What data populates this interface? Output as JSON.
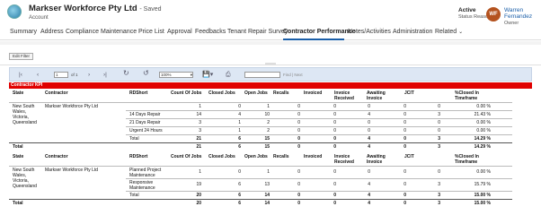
{
  "header": {
    "account_name": "Markser Workforce Pty Ltd",
    "saved_label": "- Saved",
    "entity_type": "Account",
    "status_value": "Active",
    "status_label": "Status Reason",
    "owner_initials": "WF",
    "owner_name": "Warren Fernandez",
    "owner_label": "Owner"
  },
  "tabs": [
    "Summary",
    "Address",
    "Compliance",
    "Maintenance",
    "Price List",
    "Approval",
    "Feedbacks",
    "Tenant Repair Survey",
    "Contractor Performance",
    "Notes/Activities",
    "Administration",
    "Related"
  ],
  "active_tab": "Contractor Performance",
  "toolbar": {
    "edit_filter": "Edit Filter",
    "page_number": "1",
    "of_pages": "of 1",
    "zoom": "100%",
    "find_placeholder": "",
    "find_next": "Find | Next"
  },
  "report": {
    "title": "Contractor KPI",
    "columns": [
      "State",
      "Contractor",
      "RDShort",
      "Count Of Jobs",
      "Closed Jobs",
      "Open Jobs",
      "Recalls",
      "Invoiced",
      "Invoice Received",
      "Awaiting Invoice",
      "JCIT",
      "%Closed In Timeframe"
    ],
    "section1": {
      "state": "New South Wales, Victoria, Queensland",
      "contractor": "Markser Workforce Pty Ltd",
      "rows": [
        {
          "rd": "",
          "count": "1",
          "closed": "0",
          "open": "1",
          "recalls": "0",
          "invoiced": "0",
          "inv_received": "0",
          "awaiting": "0",
          "jcit": "0",
          "pct": "0.00 %"
        },
        {
          "rd": "14 Days Repair",
          "count": "14",
          "closed": "4",
          "open": "10",
          "recalls": "0",
          "invoiced": "0",
          "inv_received": "4",
          "awaiting": "0",
          "jcit": "3",
          "pct": "21.43 %"
        },
        {
          "rd": "21 Days Repair",
          "count": "3",
          "closed": "1",
          "open": "2",
          "recalls": "0",
          "invoiced": "0",
          "inv_received": "0",
          "awaiting": "0",
          "jcit": "0",
          "pct": "0.00 %"
        },
        {
          "rd": "Urgent 24 Hours",
          "count": "3",
          "closed": "1",
          "open": "2",
          "recalls": "0",
          "invoiced": "0",
          "inv_received": "0",
          "awaiting": "0",
          "jcit": "0",
          "pct": "0.00 %"
        }
      ],
      "subtotal": {
        "label": "Total",
        "count": "21",
        "closed": "6",
        "open": "15",
        "recalls": "0",
        "invoiced": "0",
        "inv_received": "4",
        "awaiting": "0",
        "jcit": "3",
        "pct": "14.29 %"
      },
      "total": {
        "label": "Total",
        "count": "21",
        "closed": "6",
        "open": "15",
        "recalls": "0",
        "invoiced": "0",
        "inv_received": "4",
        "awaiting": "0",
        "jcit": "3",
        "pct": "14.29 %"
      }
    },
    "section2": {
      "state": "New South Wales, Victoria, Queensland",
      "contractor": "Markser Workforce Pty Ltd",
      "rows": [
        {
          "rd": "Planned Project Maintenance",
          "count": "1",
          "closed": "0",
          "open": "1",
          "recalls": "0",
          "invoiced": "0",
          "inv_received": "0",
          "awaiting": "0",
          "jcit": "0",
          "pct": "0.00 %"
        },
        {
          "rd": "Responsive Maintenance",
          "count": "19",
          "closed": "6",
          "open": "13",
          "recalls": "0",
          "invoiced": "0",
          "inv_received": "4",
          "awaiting": "0",
          "jcit": "3",
          "pct": "15.79 %"
        }
      ],
      "subtotal": {
        "label": "Total",
        "count": "20",
        "closed": "6",
        "open": "14",
        "recalls": "0",
        "invoiced": "0",
        "inv_received": "4",
        "awaiting": "0",
        "jcit": "3",
        "pct": "15.00 %"
      },
      "total": {
        "label": "Total",
        "count": "20",
        "closed": "6",
        "open": "14",
        "recalls": "0",
        "invoiced": "0",
        "inv_received": "4",
        "awaiting": "0",
        "jcit": "3",
        "pct": "15.00 %"
      }
    }
  }
}
